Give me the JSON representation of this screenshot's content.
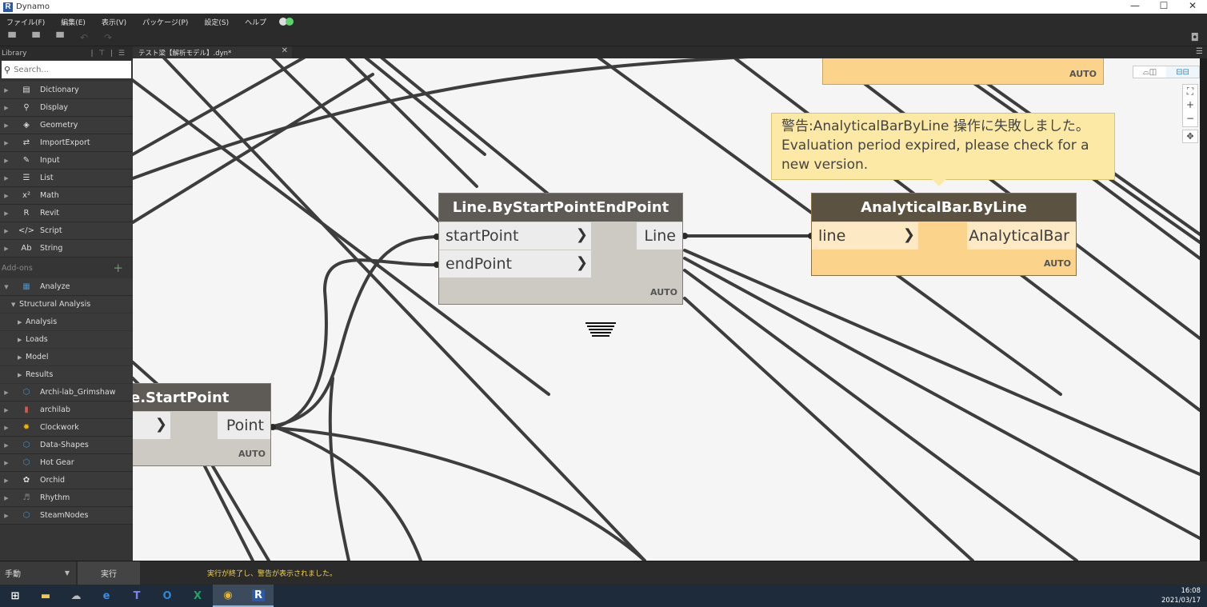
{
  "window": {
    "title": "Dynamo",
    "min": "—",
    "max": "☐",
    "close": "✕"
  },
  "menu": [
    "ファイル(F)",
    "編集(E)",
    "表示(V)",
    "パッケージ(P)",
    "設定(S)",
    "ヘルプ"
  ],
  "toolbar": {
    "new": "▀",
    "open": "▀",
    "save": "▀",
    "undo": "↶",
    "redo": "↷",
    "camera": "◘"
  },
  "library": {
    "title": "Library",
    "controls": "| ⊤ | ☰",
    "search_placeholder": "Search...",
    "categories": [
      {
        "label": "Dictionary",
        "icon": "▤"
      },
      {
        "label": "Display",
        "icon": "⚲"
      },
      {
        "label": "Geometry",
        "icon": "◈"
      },
      {
        "label": "ImportExport",
        "icon": "⇄"
      },
      {
        "label": "Input",
        "icon": "✎"
      },
      {
        "label": "List",
        "icon": "☰"
      },
      {
        "label": "Math",
        "icon": "x²"
      },
      {
        "label": "Revit",
        "icon": "R"
      },
      {
        "label": "Script",
        "icon": "</>"
      },
      {
        "label": "String",
        "icon": "Ab"
      }
    ],
    "addons_title": "Add-ons",
    "addons_plus": "+",
    "analyze": {
      "label": "Analyze",
      "icon": "▦"
    },
    "structural": {
      "label": "Structural Analysis"
    },
    "structural_children": [
      "Analysis",
      "Loads",
      "Model",
      "Results"
    ],
    "packages": [
      {
        "label": "Archi-lab_Grimshaw",
        "icon": "⬡",
        "color": "#4a90c8"
      },
      {
        "label": "archilab",
        "icon": "▮",
        "color": "#d9534f"
      },
      {
        "label": "Clockwork",
        "icon": "✹",
        "color": "#f0b400"
      },
      {
        "label": "Data-Shapes",
        "icon": "⬡",
        "color": "#4a90c8"
      },
      {
        "label": "Hot Gear",
        "icon": "⬡",
        "color": "#4a90c8"
      },
      {
        "label": "Orchid",
        "icon": "✿",
        "color": "#dddddd"
      },
      {
        "label": "Rhythm",
        "icon": "♬",
        "color": "#888888"
      },
      {
        "label": "SteamNodes",
        "icon": "⬡",
        "color": "#4a90c8"
      }
    ]
  },
  "tab": {
    "label": "テスト梁【解析モデル】.dyn*",
    "close": "✕",
    "menu": "☰"
  },
  "nodes": {
    "line": {
      "title": "Line.ByStartPointEndPoint",
      "in1": "startPoint",
      "in2": "endPoint",
      "out": "Line",
      "lacing": "AUTO"
    },
    "bar": {
      "title": "AnalyticalBar.ByLine",
      "in1": "line",
      "out": "AnalyticalBar",
      "lacing": "AUTO"
    },
    "startpoint": {
      "title": "e.StartPoint",
      "out": "Point",
      "lacing": "AUTO"
    },
    "top": {
      "lacing": "AUTO"
    }
  },
  "warning": {
    "line1": "警告:AnalyticalBarByLine 操作に失敗しました。",
    "line2": "Evaluation period expired, please check for a",
    "line3": "new version."
  },
  "view_toggle": {
    "geom": "⌓◫",
    "graph": "⊟⊟"
  },
  "zoom": {
    "fit": "⛶",
    "in": "+",
    "out": "−",
    "pan": "✥"
  },
  "runbar": {
    "mode": "手動",
    "run": "実行",
    "status": "実行が終了し、警告が表示されました。"
  },
  "taskbar": {
    "time": "16:08",
    "date": "2021/03/17"
  },
  "colors": {
    "node_header": "#5e5b56",
    "node_body": "#cdc9c3",
    "warn_header": "#5c5242",
    "warn_body": "#fbd38a",
    "warn_port": "#fde9c3",
    "accent": "#1e88c8"
  }
}
